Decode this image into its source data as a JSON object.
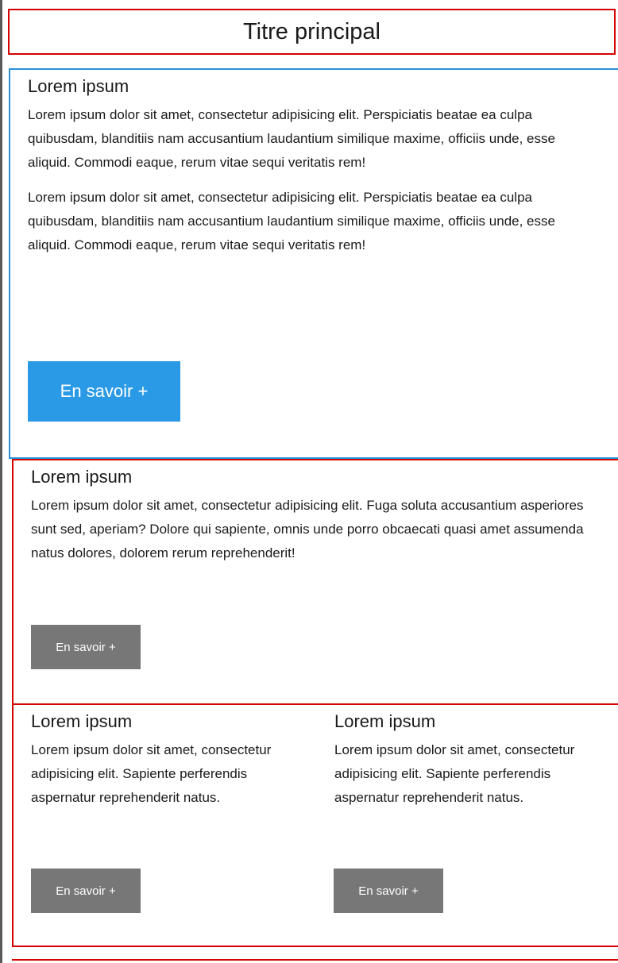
{
  "header": {
    "title": "Titre principal"
  },
  "section_main": {
    "heading": "Lorem ipsum",
    "paragraph_1": "Lorem ipsum dolor sit amet, consectetur adipisicing elit. Perspiciatis beatae ea culpa quibusdam, blanditiis nam accusantium laudantium similique maxime, officiis unde, esse aliquid. Commodi eaque, rerum vitae sequi veritatis rem!",
    "paragraph_2": "Lorem ipsum dolor sit amet, consectetur adipisicing elit. Perspiciatis beatae ea culpa quibusdam, blanditiis nam accusantium laudantium similique maxime, officiis unde, esse aliquid. Commodi eaque, rerum vitae sequi veritatis rem!",
    "button_label": "En savoir +"
  },
  "section_wide": {
    "heading": "Lorem ipsum",
    "paragraph": "Lorem ipsum dolor sit amet, consectetur adipisicing elit. Fuga soluta accusantium asperiores sunt sed, aperiam? Dolore qui sapiente, omnis unde porro obcaecati quasi amet assumenda natus dolores, dolorem rerum reprehenderit!",
    "button_label": "En savoir +"
  },
  "section_left": {
    "heading": "Lorem ipsum",
    "paragraph": "Lorem ipsum dolor sit amet, consectetur adipisicing elit. Sapiente perferendis aspernatur reprehenderit natus.",
    "button_label": "En savoir +"
  },
  "section_right": {
    "heading": "Lorem ipsum",
    "paragraph": "Lorem ipsum dolor sit amet, consectetur adipisicing elit. Sapiente perferendis aspernatur reprehenderit natus.",
    "button_label": "En savoir +"
  },
  "colors": {
    "accent_blue": "#2a9ae6",
    "border_red": "#d40000",
    "border_blue": "#2a8fd8",
    "button_grey": "#777777"
  }
}
